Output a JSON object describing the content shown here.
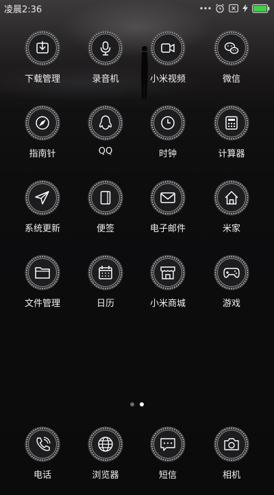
{
  "status_bar": {
    "time": "凌晨2:36",
    "battery_color": "#3ecf4a"
  },
  "apps": [
    {
      "label": "下载管理",
      "icon": "download-icon"
    },
    {
      "label": "录音机",
      "icon": "microphone-icon"
    },
    {
      "label": "小米视频",
      "icon": "video-camera-icon"
    },
    {
      "label": "微信",
      "icon": "wechat-icon"
    },
    {
      "label": "指南针",
      "icon": "compass-icon"
    },
    {
      "label": "QQ",
      "icon": "qq-penguin-icon"
    },
    {
      "label": "时钟",
      "icon": "clock-icon"
    },
    {
      "label": "计算器",
      "icon": "calculator-icon"
    },
    {
      "label": "系统更新",
      "icon": "paper-plane-icon"
    },
    {
      "label": "便签",
      "icon": "notepad-icon"
    },
    {
      "label": "电子邮件",
      "icon": "envelope-icon"
    },
    {
      "label": "米家",
      "icon": "home-icon"
    },
    {
      "label": "文件管理",
      "icon": "folder-icon"
    },
    {
      "label": "日历",
      "icon": "calendar-icon"
    },
    {
      "label": "小米商城",
      "icon": "store-icon"
    },
    {
      "label": "游戏",
      "icon": "gamepad-icon"
    }
  ],
  "dock": [
    {
      "label": "电话",
      "icon": "phone-icon"
    },
    {
      "label": "浏览器",
      "icon": "globe-icon"
    },
    {
      "label": "短信",
      "icon": "message-icon"
    },
    {
      "label": "相机",
      "icon": "camera-icon"
    }
  ],
  "pages": {
    "count": 2,
    "current": 2
  }
}
